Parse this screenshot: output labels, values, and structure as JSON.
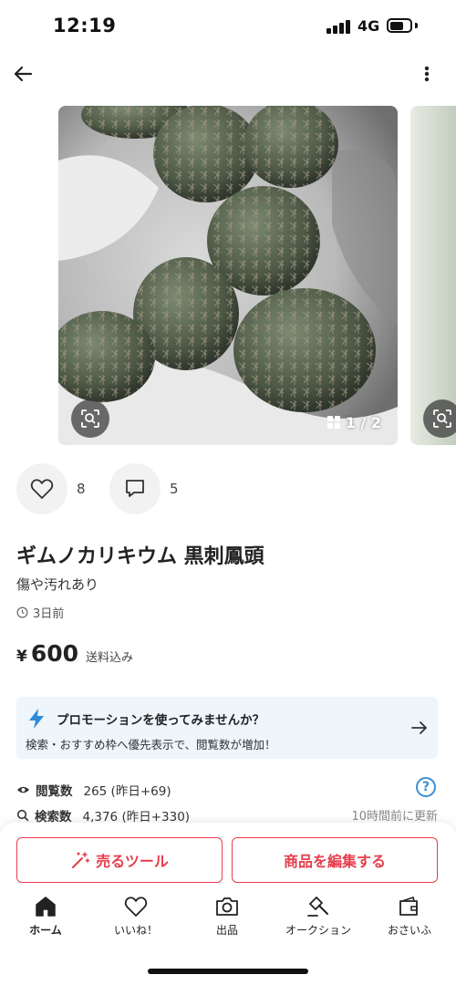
{
  "status_bar": {
    "time": "12:19",
    "network": "4G"
  },
  "images": {
    "counter": "1 / 2"
  },
  "actions": {
    "likes": "8",
    "comments": "5"
  },
  "item": {
    "title": "ギムノカリキウム 黒刺鳳頭",
    "condition": "傷や汚れあり",
    "posted": "3日前",
    "price_currency": "¥",
    "price": "600",
    "shipping_note": "送料込み"
  },
  "promotion": {
    "title": "プロモーションを使ってみませんか？",
    "subtitle": "検索・おすすめ枠へ優先表示で、閲覧数が増加！"
  },
  "stats": {
    "views_label": "閲覧数",
    "views_value": "265 (昨日+69)",
    "searches_label": "検索数",
    "searches_value": "4,376 (昨日+330)",
    "updated": "10時間前に更新"
  },
  "buttons": {
    "sell_tools": "売るツール",
    "edit_item": "商品を編集する"
  },
  "tabbar": {
    "items": [
      {
        "label": "ホーム",
        "icon": "home-icon"
      },
      {
        "label": "いいね！",
        "icon": "heart-icon"
      },
      {
        "label": "出品",
        "icon": "camera-icon"
      },
      {
        "label": "オークション",
        "icon": "gavel-icon"
      },
      {
        "label": "おさいふ",
        "icon": "wallet-icon"
      }
    ]
  },
  "colors": {
    "accent": "#e53d4c",
    "promo_bg": "#eef5fb",
    "promo_icon": "#2e8bd8"
  }
}
